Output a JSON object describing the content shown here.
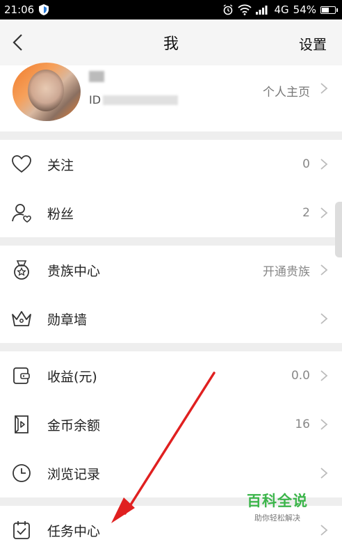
{
  "status_bar": {
    "time": "21:06",
    "network": "4G",
    "battery": "54%"
  },
  "nav": {
    "title": "我",
    "settings_label": "设置"
  },
  "profile": {
    "id_label": "ID",
    "homepage_label": "个人主页"
  },
  "sections": {
    "social": [
      {
        "label": "关注",
        "value": "0"
      },
      {
        "label": "粉丝",
        "value": "2"
      }
    ],
    "privilege": [
      {
        "label": "贵族中心",
        "value": "开通贵族"
      },
      {
        "label": "勋章墙",
        "value": ""
      }
    ],
    "wallet": [
      {
        "label": "收益(元)",
        "value": "0.0"
      },
      {
        "label": "金币余额",
        "value": "16"
      },
      {
        "label": "浏览记录",
        "value": ""
      }
    ],
    "tasks": [
      {
        "label": "任务中心",
        "value": ""
      }
    ]
  },
  "watermark": {
    "title": "百科全说",
    "subtitle": "助你轻松解决"
  }
}
